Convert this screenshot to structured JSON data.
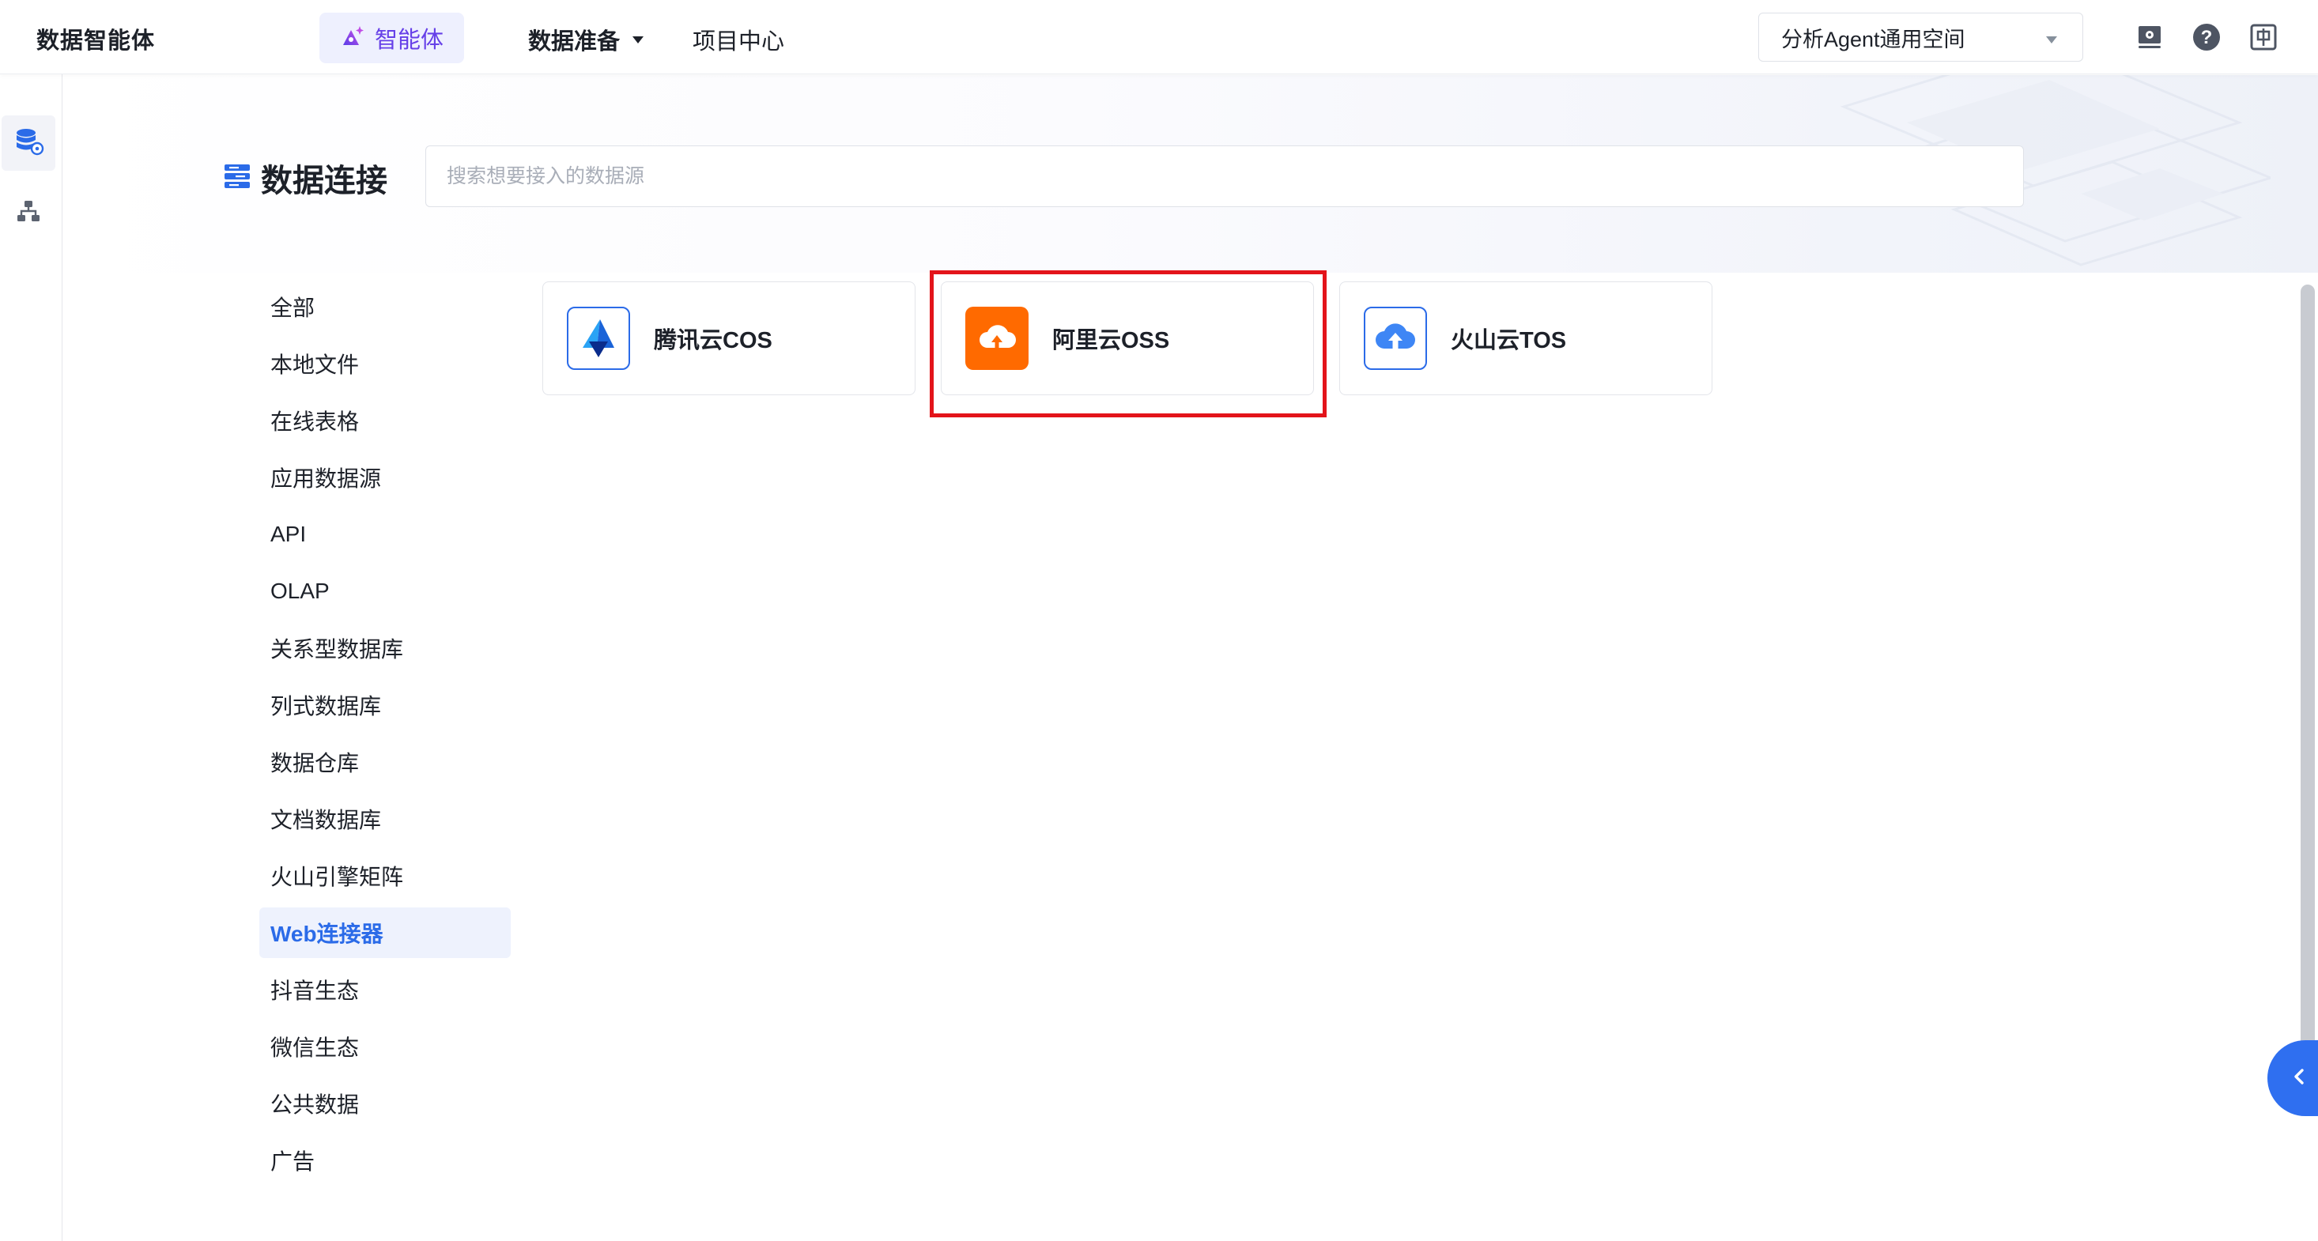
{
  "header": {
    "brand": "数据智能体",
    "nav": {
      "agent_label": "智能体",
      "data_prep_label": "数据准备",
      "project_label": "项目中心"
    },
    "workspace": {
      "selected": "分析Agent通用空间"
    },
    "icons": [
      "monitor-gear-icon",
      "help-icon",
      "language-zh-icon"
    ]
  },
  "rail": {
    "items": [
      {
        "icon": "database-settings-icon",
        "active": true
      },
      {
        "icon": "org-tree-icon",
        "active": false
      }
    ]
  },
  "page": {
    "title": "数据连接",
    "search_placeholder": "搜索想要接入的数据源"
  },
  "categories": [
    {
      "label": "全部"
    },
    {
      "label": "本地文件"
    },
    {
      "label": "在线表格"
    },
    {
      "label": "应用数据源"
    },
    {
      "label": "API"
    },
    {
      "label": "OLAP"
    },
    {
      "label": "关系型数据库"
    },
    {
      "label": "列式数据库"
    },
    {
      "label": "数据仓库"
    },
    {
      "label": "文档数据库"
    },
    {
      "label": "火山引擎矩阵"
    },
    {
      "label": "Web连接器",
      "active": true
    },
    {
      "label": "抖音生态"
    },
    {
      "label": "微信生态"
    },
    {
      "label": "公共数据"
    },
    {
      "label": "广告"
    }
  ],
  "connectors": [
    {
      "name": "腾讯云COS",
      "icon": "tencent-cos-logo-icon"
    },
    {
      "name": "阿里云OSS",
      "icon": "aliyun-oss-logo-icon",
      "highlighted": true
    },
    {
      "name": "火山云TOS",
      "icon": "volcano-tos-logo-icon"
    }
  ],
  "colors": {
    "accent_blue": "#2b6be8",
    "agent_purple": "#6640e8",
    "highlight_red": "#e3141a",
    "aliyun_orange": "#ff6a00"
  }
}
